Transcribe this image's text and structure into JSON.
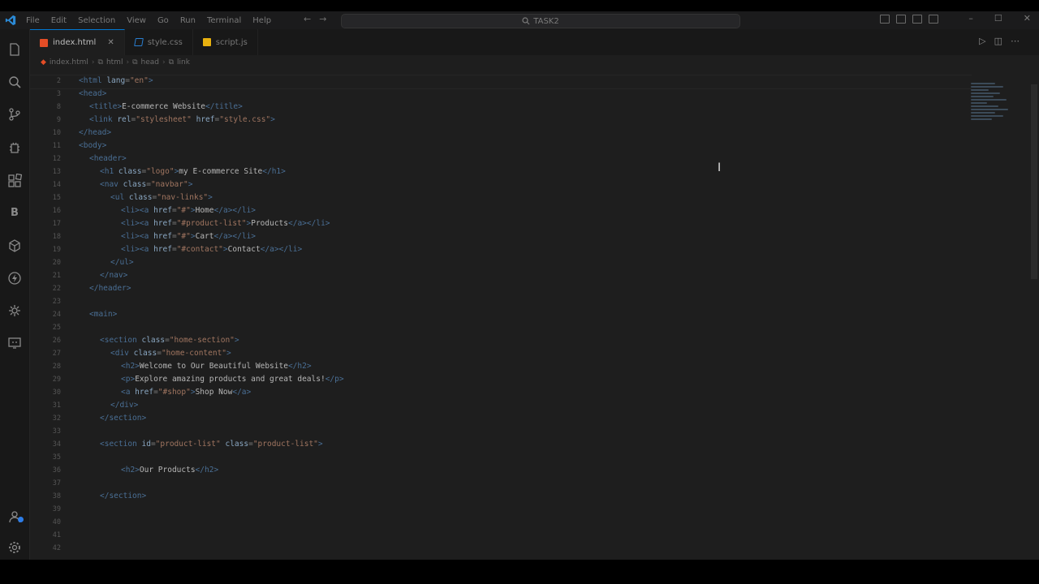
{
  "window": {
    "menu": [
      "File",
      "Edit",
      "Selection",
      "View",
      "Go",
      "Run",
      "Terminal",
      "Help"
    ],
    "search_text": "TASK2"
  },
  "tabs": [
    {
      "label": "index.html",
      "type": "html",
      "active": true
    },
    {
      "label": "style.css",
      "type": "css",
      "active": false
    },
    {
      "label": "script.js",
      "type": "js",
      "active": false
    }
  ],
  "breadcrumb": [
    "index.html",
    "html",
    "head",
    "link"
  ],
  "colors": {
    "accent": "#0078d4",
    "html_icon": "#e44d26",
    "css_icon": "#2a7fd1",
    "js_icon": "#e8b10f",
    "badge": "#2d7de8"
  },
  "activity_icons": [
    "explorer-icon",
    "search-icon",
    "source-control-icon",
    "run-debug-icon",
    "extensions-icon",
    "bootstrap-icon",
    "package-icon",
    "lightning-icon",
    "copilot-icon",
    "remote-icon",
    "account-icon",
    "settings-gear-icon"
  ],
  "code_lines": [
    {
      "n": "2",
      "indent": 0,
      "text": "<html lang=\"en\">"
    },
    {
      "n": "3",
      "indent": 0,
      "text": "<head>"
    },
    {
      "n": "8",
      "indent": 1,
      "text": "<title>E-commerce Website</title>"
    },
    {
      "n": "9",
      "indent": 1,
      "text": "<link rel=\"stylesheet\" href=\"style.css\">"
    },
    {
      "n": "10",
      "indent": 0,
      "text": "</head>"
    },
    {
      "n": "11",
      "indent": 0,
      "text": "<body>"
    },
    {
      "n": "12",
      "indent": 1,
      "text": "<header>"
    },
    {
      "n": "13",
      "indent": 2,
      "text": "<h1 class=\"logo\">my E-commerce Site</h1>"
    },
    {
      "n": "14",
      "indent": 2,
      "text": "<nav class=\"navbar\">"
    },
    {
      "n": "15",
      "indent": 3,
      "text": "<ul class=\"nav-links\">"
    },
    {
      "n": "16",
      "indent": 4,
      "text": "<li><a href=\"#\">Home</a></li>"
    },
    {
      "n": "17",
      "indent": 4,
      "text": "<li><a href=\"#product-list\">Products</a></li>"
    },
    {
      "n": "18",
      "indent": 4,
      "text": "<li><a href=\"#\">Cart</a></li>"
    },
    {
      "n": "19",
      "indent": 4,
      "text": "<li><a href=\"#contact\">Contact</a></li>"
    },
    {
      "n": "20",
      "indent": 3,
      "text": "</ul>"
    },
    {
      "n": "21",
      "indent": 2,
      "text": "</nav>"
    },
    {
      "n": "22",
      "indent": 1,
      "text": "</header>"
    },
    {
      "n": "23",
      "indent": 0,
      "text": ""
    },
    {
      "n": "24",
      "indent": 1,
      "text": "<main>"
    },
    {
      "n": "25",
      "indent": 0,
      "text": ""
    },
    {
      "n": "26",
      "indent": 2,
      "text": "<section class=\"home-section\">"
    },
    {
      "n": "27",
      "indent": 3,
      "text": "<div class=\"home-content\">"
    },
    {
      "n": "28",
      "indent": 4,
      "text": "<h2>Welcome to Our Beautiful Website</h2>"
    },
    {
      "n": "29",
      "indent": 4,
      "text": "<p>Explore amazing products and great deals!</p>"
    },
    {
      "n": "30",
      "indent": 4,
      "text": "<a href=\"#shop\">Shop Now</a>"
    },
    {
      "n": "31",
      "indent": 3,
      "text": "</div>"
    },
    {
      "n": "32",
      "indent": 2,
      "text": "</section>"
    },
    {
      "n": "33",
      "indent": 0,
      "text": ""
    },
    {
      "n": "34",
      "indent": 2,
      "text": "<section id=\"product-list\" class=\"product-list\">"
    },
    {
      "n": "35",
      "indent": 0,
      "text": ""
    },
    {
      "n": "36",
      "indent": 4,
      "text": "<h2>Our Products</h2>"
    },
    {
      "n": "37",
      "indent": 0,
      "text": ""
    },
    {
      "n": "38",
      "indent": 2,
      "text": "</section>"
    },
    {
      "n": "39",
      "indent": 0,
      "text": ""
    },
    {
      "n": "40",
      "indent": 0,
      "text": ""
    },
    {
      "n": "41",
      "indent": 0,
      "text": ""
    },
    {
      "n": "42",
      "indent": 0,
      "text": ""
    }
  ]
}
